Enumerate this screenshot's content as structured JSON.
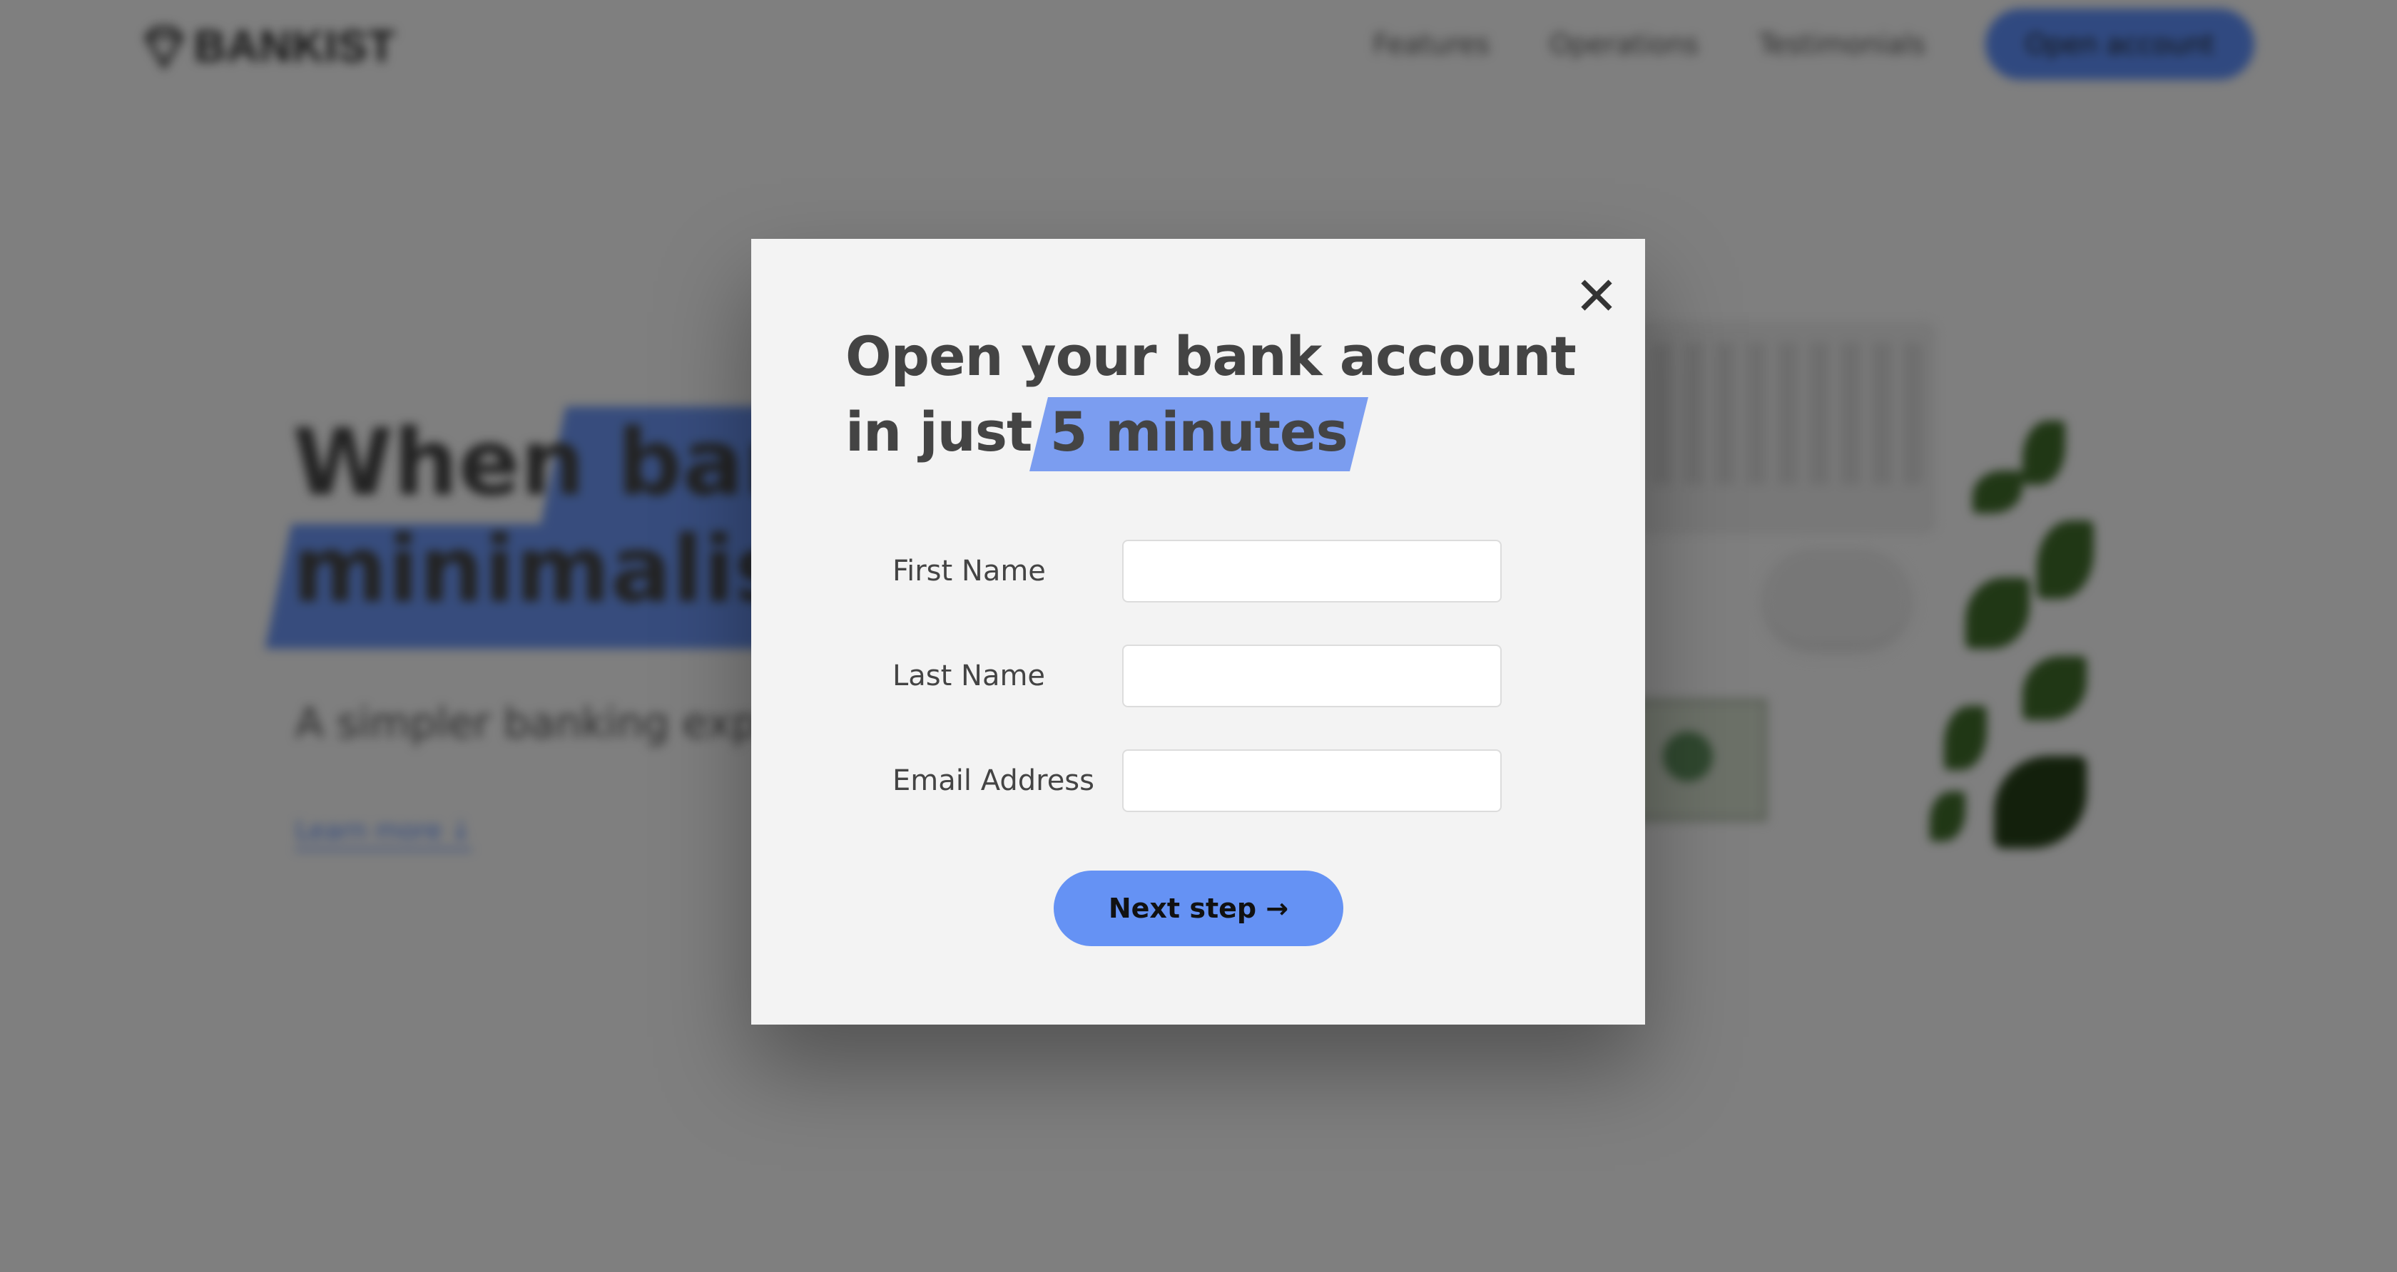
{
  "header": {
    "logo_text": "BANKIST",
    "nav": [
      "Features",
      "Operations",
      "Testimonials"
    ],
    "cta": "Open account"
  },
  "hero": {
    "title_line1": "When banking meets",
    "title_line2": "minimalist",
    "subtitle": "A simpler banking experience for a simpler life.",
    "link": "Learn more ↓"
  },
  "modal": {
    "title_line1": "Open your bank account",
    "title_line2_prefix": "in just ",
    "title_highlight": "5 minutes",
    "fields": [
      {
        "label": "First Name",
        "value": ""
      },
      {
        "label": "Last Name",
        "value": ""
      },
      {
        "label": "Email Address",
        "value": ""
      }
    ],
    "next_button": "Next step →",
    "close_icon": "✕"
  },
  "colors": {
    "accent": "#6592f4",
    "highlight": "#7b9df0",
    "modal_bg": "#f3f3f3",
    "overlay": "rgba(0,0,0,0.48)"
  }
}
